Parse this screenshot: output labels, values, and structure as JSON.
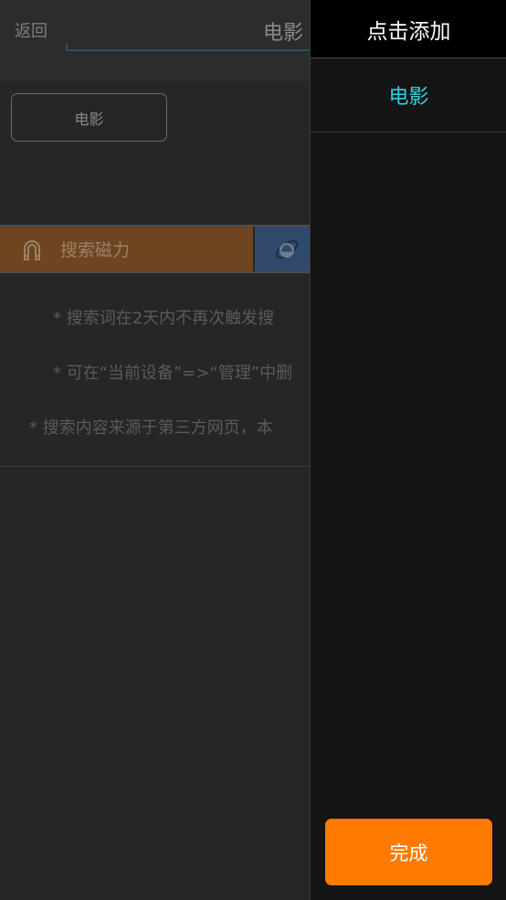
{
  "header": {
    "back_label": "返回",
    "search_value": "电影"
  },
  "history": {
    "chips": [
      "电影"
    ]
  },
  "engines": {
    "magnet_label": "搜索磁力",
    "magnet_icon": "magnet-icon",
    "ie_icon": "ie-browser-icon",
    "magnet_color": "#6e4421",
    "ie_color": "#31496a"
  },
  "notes": [
    "* 搜索词在2天内不再次触发搜",
    "* 可在“当前设备”=>“管理”中删",
    "* 搜索内容来源于第三方网页，本"
  ],
  "drawer": {
    "title": "点击添加",
    "items": [
      "电影"
    ],
    "done_label": "完成",
    "accent_color": "#2fd2e6",
    "done_color": "#ff7a00"
  }
}
